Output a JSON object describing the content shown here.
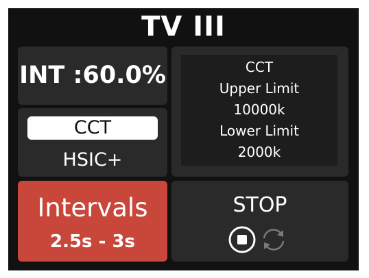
{
  "header": {
    "title": "TV III"
  },
  "intensity": {
    "text": "INT :60.0%"
  },
  "mode": {
    "selected": "CCT",
    "other": "HSIC+"
  },
  "limits": {
    "lines": [
      "CCT",
      "Upper Limit",
      "10000k",
      "Lower Limit",
      "2000k"
    ]
  },
  "intervals": {
    "label": "Intervals",
    "range": "2.5s - 3s",
    "color": "#c8463a"
  },
  "playback": {
    "label": "STOP",
    "stop_icon": "stop-circle-icon",
    "loop_icon": "loop-icon"
  },
  "colors": {
    "background": "#111111",
    "panel": "#2a2a2a",
    "inner": "#1d1d1d",
    "text": "#ffffff"
  }
}
